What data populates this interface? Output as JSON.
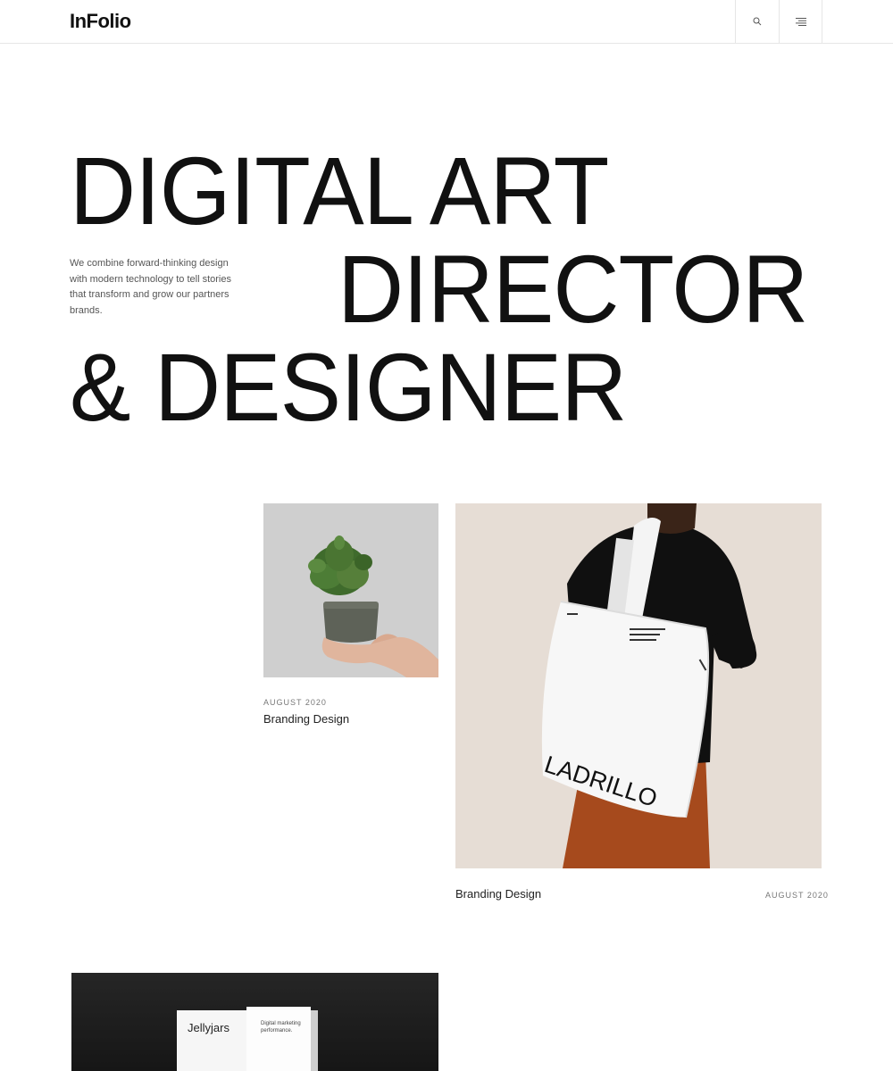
{
  "header": {
    "logo": "InFolio"
  },
  "hero": {
    "line1": "DIGITAL ART",
    "line2": "DIRECTOR",
    "line3": "& DESIGNER",
    "intro": "We combine forward-thinking design with modern technology to tell stories that transform and grow our partners brands."
  },
  "projects": [
    {
      "date": "AUGUST 2020",
      "title": "Branding Design"
    },
    {
      "date": "AUGUST 2020",
      "title": "Branding Design",
      "bag_text": "LADRILLO"
    },
    {
      "box_brand": "Jellyjars",
      "box_tagline": "Digital marketing performance."
    }
  ]
}
